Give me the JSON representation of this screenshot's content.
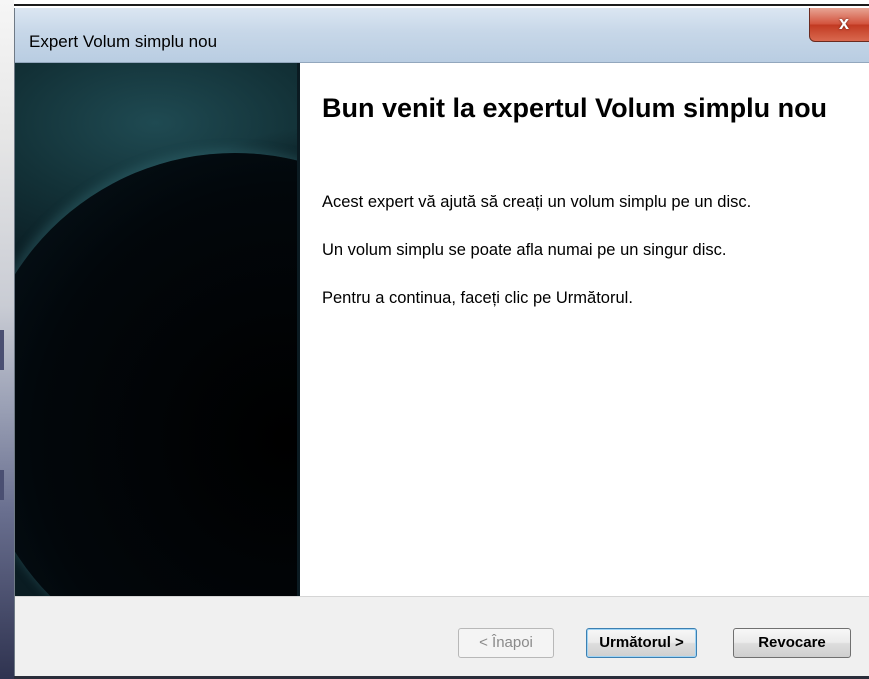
{
  "window": {
    "title": "Expert Volum simplu nou",
    "close_label": "x"
  },
  "content": {
    "heading": "Bun venit la expertul Volum simplu nou",
    "paragraphs": [
      "Acest expert vă ajută să creați un volum simplu pe un disc.",
      "Un volum simplu se poate afla numai pe un singur disc.",
      "Pentru a continua, faceți clic pe Următorul."
    ]
  },
  "buttons": {
    "back": "< Înapoi",
    "next": "Următorul >",
    "cancel": "Revocare"
  }
}
